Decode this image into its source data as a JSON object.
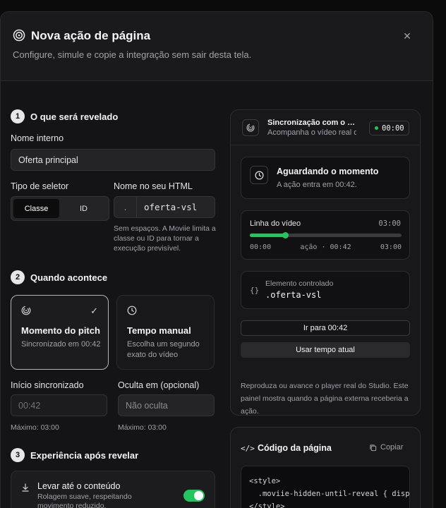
{
  "header": {
    "title": "Nova ação de página",
    "subtitle": "Configure, simule e copie a integração sem sair desta tela.",
    "close_icon": "close-icon"
  },
  "form": {
    "step1": {
      "num": "1",
      "title": "O que será revelado"
    },
    "internal_name": {
      "label": "Nome interno",
      "value": "Oferta principal"
    },
    "selector_type": {
      "label": "Tipo de seletor",
      "options": [
        "Classe",
        "ID"
      ],
      "selected": "Classe"
    },
    "html_name": {
      "label": "Nome no seu HTML",
      "prefix": ".",
      "value": "oferta-vsl",
      "help": "Sem espaços. A Moviie limita a classe ou ID para tornar a execução previsível."
    },
    "step2": {
      "num": "2",
      "title": "Quando acontece"
    },
    "modes": [
      {
        "title": "Momento do pitch",
        "desc": "Sincronizado em 00:42",
        "icon": "fingerprint-icon",
        "selected": true
      },
      {
        "title": "Tempo manual",
        "desc": "Escolha um segundo exato do vídeo",
        "icon": "clock-icon",
        "selected": false
      }
    ],
    "sync_start": {
      "label": "Início sincronizado",
      "value": "00:42",
      "help": "Máximo: 03:00"
    },
    "hide_at": {
      "label": "Oculta em (opcional)",
      "placeholder": "Não oculta",
      "help": "Máximo: 03:00"
    },
    "step3": {
      "num": "3",
      "title": "Experiência após revelar"
    },
    "scroll_option": {
      "title": "Levar até o conteúdo",
      "desc": "Rolagem suave, respeitando movimento reduzido.",
      "enabled": true,
      "icon": "arrow-down-icon"
    }
  },
  "sync": {
    "title": "Sincronização com o player",
    "subtitle": "Acompanha o vídeo real do Studio",
    "time": "00:00",
    "waiting_title": "Aguardando o momento",
    "waiting_sub": "A ação entra em 00:42.",
    "timeline_label": "Linha do vídeo",
    "timeline_total": "03:00",
    "timeline_start": "00:00",
    "timeline_action": "ação · 00:42",
    "timeline_end": "03:00",
    "action_fraction": 0.233,
    "element_label": "Elemento controlado",
    "element_value": ".oferta-vsl",
    "goto_button": "Ir para 00:42",
    "use_time_button": "Usar tempo atual",
    "help": "Reproduza ou avance o player real do Studio. Este painel mostra quando a página externa receberia a ação."
  },
  "code": {
    "title": "Código da página",
    "copy_label": "Copiar",
    "lines": [
      "<style>",
      "  .moviie-hidden-until-reveal { display: none; }",
      "</style>"
    ]
  },
  "colors": {
    "accent": "#22c55e",
    "background": "#141416"
  }
}
